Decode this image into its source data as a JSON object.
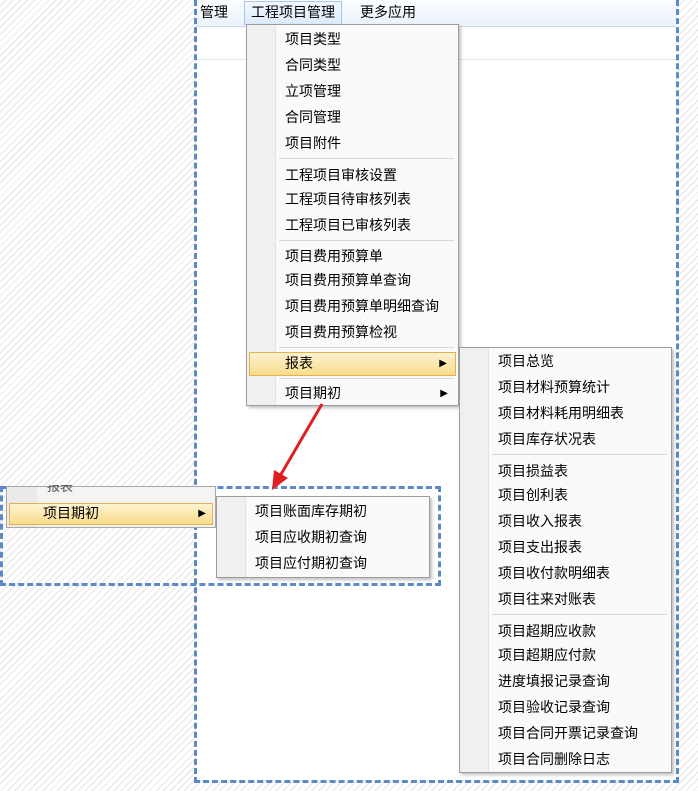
{
  "menubar": {
    "items": [
      {
        "label": "管理"
      },
      {
        "label": "工程项目管理"
      },
      {
        "label": "更多应用"
      }
    ]
  },
  "main_menu": {
    "items": [
      {
        "label": "项目类型"
      },
      {
        "label": "合同类型"
      },
      {
        "label": "立项管理"
      },
      {
        "label": "合同管理"
      },
      {
        "label": "项目附件"
      },
      {
        "label": "工程项目审核设置"
      },
      {
        "label": "工程项目待审核列表"
      },
      {
        "label": "工程项目已审核列表"
      },
      {
        "label": "项目费用预算单"
      },
      {
        "label": "项目费用预算单查询"
      },
      {
        "label": "项目费用预算单明细查询"
      },
      {
        "label": "项目费用预算检视"
      },
      {
        "label": "报表"
      },
      {
        "label": "项目期初"
      }
    ]
  },
  "report_submenu": {
    "items": [
      {
        "label": "项目总览"
      },
      {
        "label": "项目材料预算统计"
      },
      {
        "label": "项目材料耗用明细表"
      },
      {
        "label": "项目库存状况表"
      },
      {
        "label": "项目损益表"
      },
      {
        "label": "项目创利表"
      },
      {
        "label": "项目收入报表"
      },
      {
        "label": "项目支出报表"
      },
      {
        "label": "项目收付款明细表"
      },
      {
        "label": "项目往来对账表"
      },
      {
        "label": "项目超期应收款"
      },
      {
        "label": "项目超期应付款"
      },
      {
        "label": "进度填报记录查询"
      },
      {
        "label": "项目验收记录查询"
      },
      {
        "label": "项目合同开票记录查询"
      },
      {
        "label": "项目合同删除日志"
      }
    ]
  },
  "left_menu": {
    "clipped_label": "报表",
    "item_label": "项目期初"
  },
  "opening_submenu": {
    "items": [
      {
        "label": "项目账面库存期初"
      },
      {
        "label": "项目应收期初查询"
      },
      {
        "label": "项目应付期初查询"
      }
    ]
  },
  "colors": {
    "dash_frame": "#5b8ac6",
    "arrow": "#e02020",
    "highlight": "#f9dc8b"
  },
  "icons": {
    "submenu_arrow": "▶"
  }
}
